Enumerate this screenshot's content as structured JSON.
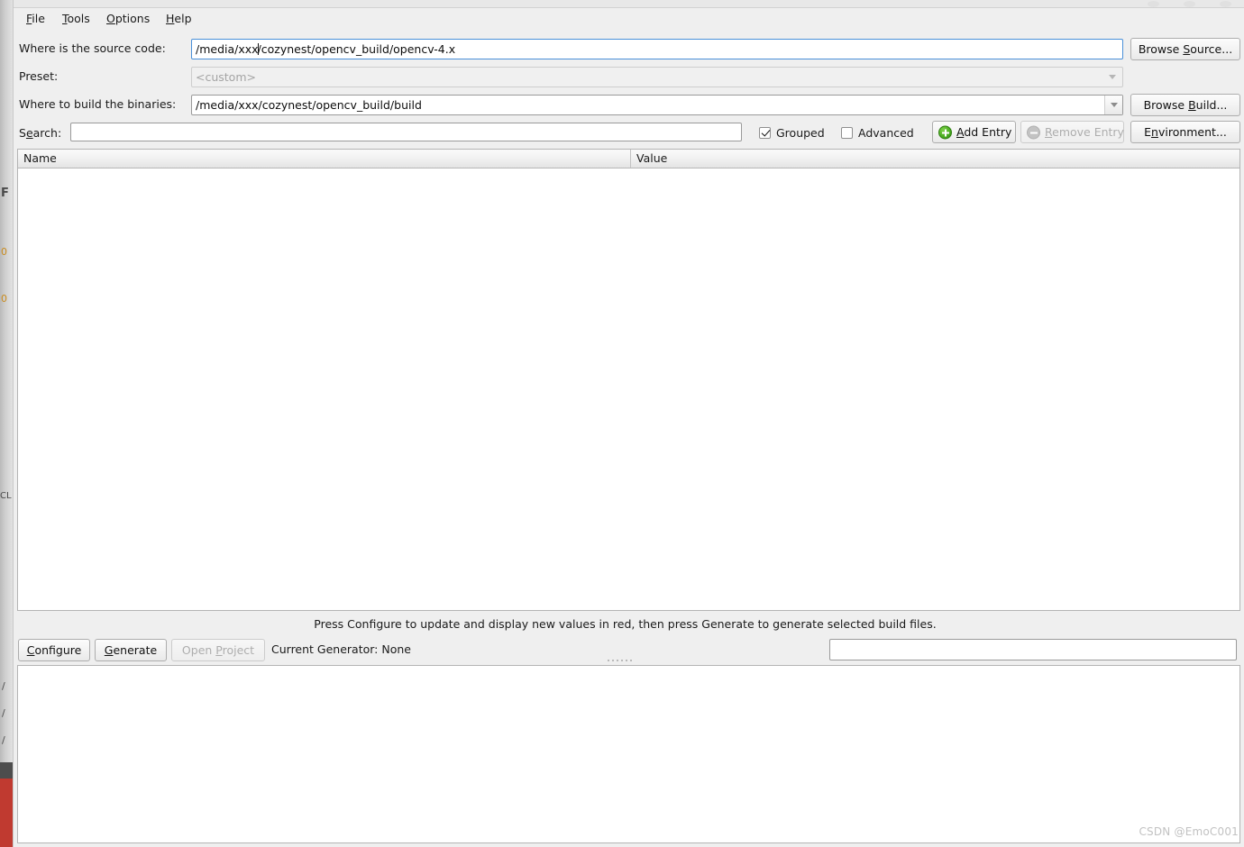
{
  "window": {
    "controls": [
      "minimize-dot",
      "maximize-dot",
      "close-dot"
    ]
  },
  "menubar": {
    "items": [
      {
        "label": "File",
        "mnemonic": "F"
      },
      {
        "label": "Tools",
        "mnemonic": "T"
      },
      {
        "label": "Options",
        "mnemonic": "O"
      },
      {
        "label": "Help",
        "mnemonic": "H"
      }
    ]
  },
  "form": {
    "source_label": "Where is the source code:",
    "source_value": "/media/xxx/cozynest/opencv_build/opencv-4.x",
    "browse_source_label": "Browse Source...",
    "browse_source_mnemonic": "S",
    "preset_label": "Preset:",
    "preset_value": "<custom>",
    "build_label": "Where to build the binaries:",
    "build_value": "/media/xxx/cozynest/opencv_build/build",
    "browse_build_label": "Browse Build...",
    "browse_build_mnemonic": "B"
  },
  "toolbar": {
    "search_label": "Search:",
    "search_mnemonic": "e",
    "search_value": "",
    "search_placeholder": "",
    "grouped_label": "Grouped",
    "grouped_checked": true,
    "advanced_label": "Advanced",
    "advanced_checked": false,
    "add_entry_label": "Add Entry",
    "add_entry_mnemonic": "A",
    "add_entry_enabled": true,
    "remove_entry_label": "Remove Entry",
    "remove_entry_mnemonic": "R",
    "remove_entry_enabled": false,
    "environment_label": "Environment...",
    "environment_mnemonic": "n"
  },
  "cache_table": {
    "columns": [
      "Name",
      "Value"
    ],
    "rows": []
  },
  "status": {
    "hint": "Press Configure to update and display new values in red, then press Generate to generate selected build files."
  },
  "actions": {
    "configure_label": "Configure",
    "configure_mnemonic": "C",
    "configure_enabled": true,
    "generate_label": "Generate",
    "generate_mnemonic": "G",
    "generate_enabled": true,
    "open_project_label": "Open Project",
    "open_project_mnemonic": "P",
    "open_project_enabled": false,
    "current_generator_label": "Current Generator: None",
    "progress_value": ""
  },
  "console": {
    "text": ""
  },
  "watermark": {
    "text": "CSDN @EmoC001"
  },
  "background_window": {
    "glyphs": [
      "F",
      "0",
      "0",
      "CL",
      "/",
      "/",
      "/",
      "/"
    ],
    "accent_color": "#c03a30"
  },
  "colors": {
    "window_bg": "#efefef",
    "field_bg": "#ffffff",
    "focus_border": "#4a90d9",
    "add_icon_green": "#4caf23",
    "disabled_text": "#adadad"
  }
}
